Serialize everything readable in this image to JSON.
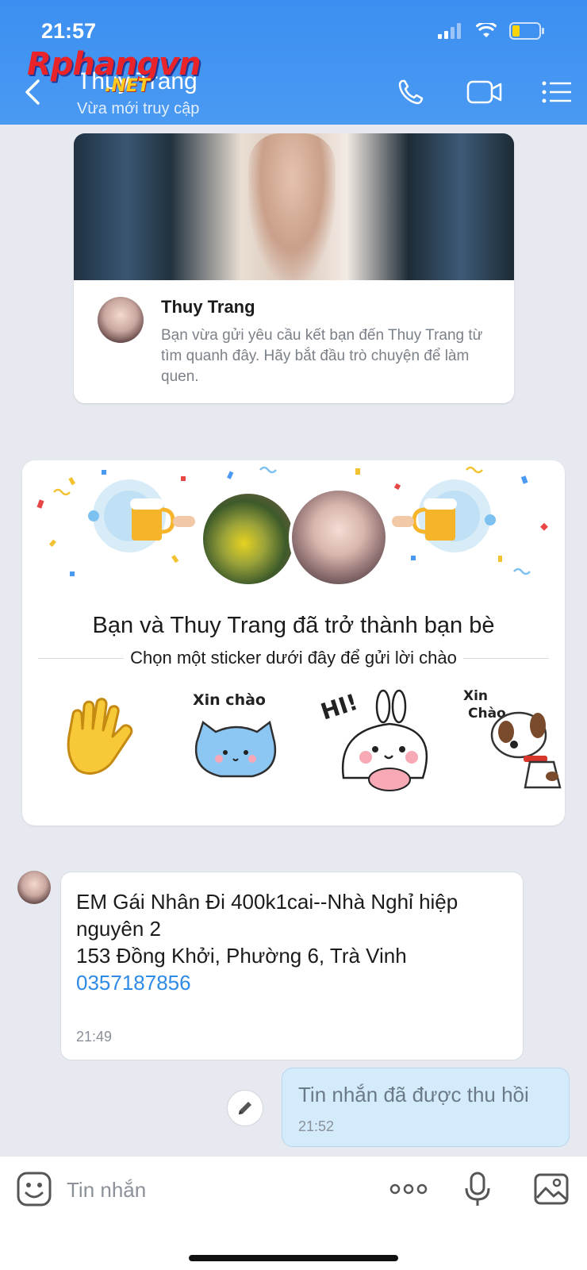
{
  "status_bar": {
    "time": "21:57"
  },
  "watermark": {
    "main": "Rphangvn",
    "sub": ".NET"
  },
  "header": {
    "contact_name": "Thuy Trang",
    "contact_status": "Vừa mới truy cập"
  },
  "profile_card": {
    "name": "Thuy Trang",
    "description": "Bạn vừa gửi yêu cầu kết bạn đến Thuy Trang từ tìm quanh đây. Hãy bắt đầu trò chuyện để làm quen."
  },
  "friend_card": {
    "title": "Bạn và Thuy Trang đã trở thành bạn bè",
    "subtitle": "Chọn một sticker dưới đây để gửi lời chào",
    "stickers": {
      "cat_text": "Xin chào",
      "bunny_text": "HI!",
      "dog_text_1": "Xin",
      "dog_text_2": "Chào"
    }
  },
  "messages": {
    "incoming": {
      "line1": "EM Gái Nhân Đi 400k1cai--Nhà Nghỉ hiệp",
      "line2": "nguyên 2",
      "line3": "153 Đồng Khởi, Phường 6, Trà Vinh",
      "phone": "0357187856",
      "time": "21:49"
    },
    "outgoing": {
      "text": "Tin nhắn đã được thu hồi",
      "time": "21:52"
    }
  },
  "input_bar": {
    "placeholder": "Tin nhắn"
  },
  "colors": {
    "header_blue": "#3c8ff0",
    "link_blue": "#2f8ae5",
    "outgoing_bubble": "#d4ebfb"
  }
}
